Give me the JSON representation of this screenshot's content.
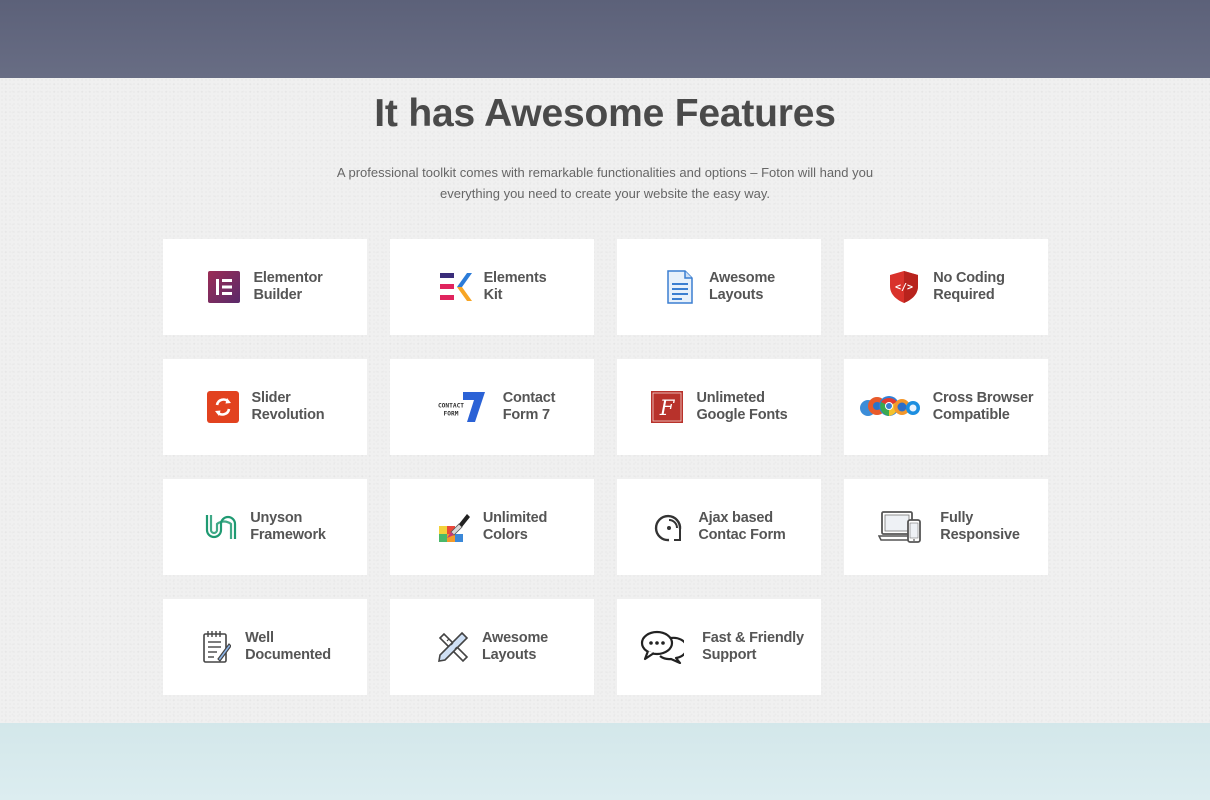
{
  "heading": {
    "title": "It has Awesome Features",
    "subtitle_line1": "A professional toolkit comes with remarkable functionalities and options – Foton will hand you",
    "subtitle_line2": "everything you need to create your website the easy way."
  },
  "features": [
    {
      "line1": "Elementor",
      "line2": "Builder",
      "icon": "elementor-icon"
    },
    {
      "line1": "Elements",
      "line2": "Kit",
      "icon": "elements-kit-icon"
    },
    {
      "line1": "Awesome",
      "line2": "Layouts",
      "icon": "document-icon"
    },
    {
      "line1": "No Coding",
      "line2": "Required",
      "icon": "code-shield-icon"
    },
    {
      "line1": "Slider",
      "line2": "Revolution",
      "icon": "slider-revolution-icon"
    },
    {
      "line1": "Contact",
      "line2": "Form 7",
      "icon": "contact-form-7-icon",
      "icon_text1": "CONTACT",
      "icon_text2": "FORM"
    },
    {
      "line1": "Unlimeted",
      "line2": "Google Fonts",
      "icon": "google-fonts-icon"
    },
    {
      "line1": "Cross Browser",
      "line2": "Compatible",
      "icon": "browsers-icon"
    },
    {
      "line1": "Unyson",
      "line2": "Framework",
      "icon": "unyson-icon"
    },
    {
      "line1": "Unlimited",
      "line2": "Colors",
      "icon": "paint-brush-icon"
    },
    {
      "line1": "Ajax based",
      "line2": "Contac Form",
      "icon": "ajax-icon"
    },
    {
      "line1": "Fully",
      "line2": "Responsive",
      "icon": "devices-icon"
    },
    {
      "line1": "Well",
      "line2": "Documented",
      "icon": "notepad-icon"
    },
    {
      "line1": "Awesome",
      "line2": "Layouts",
      "icon": "design-tools-icon"
    },
    {
      "line1": "Fast & Friendly",
      "line2": "Support",
      "icon": "chat-bubbles-icon"
    }
  ],
  "colors": {
    "top_band": "#60657c",
    "section_bg": "#f0f0f0",
    "bottom_band": "#d6eaed",
    "title": "#4a4a4a",
    "label": "#555555"
  }
}
